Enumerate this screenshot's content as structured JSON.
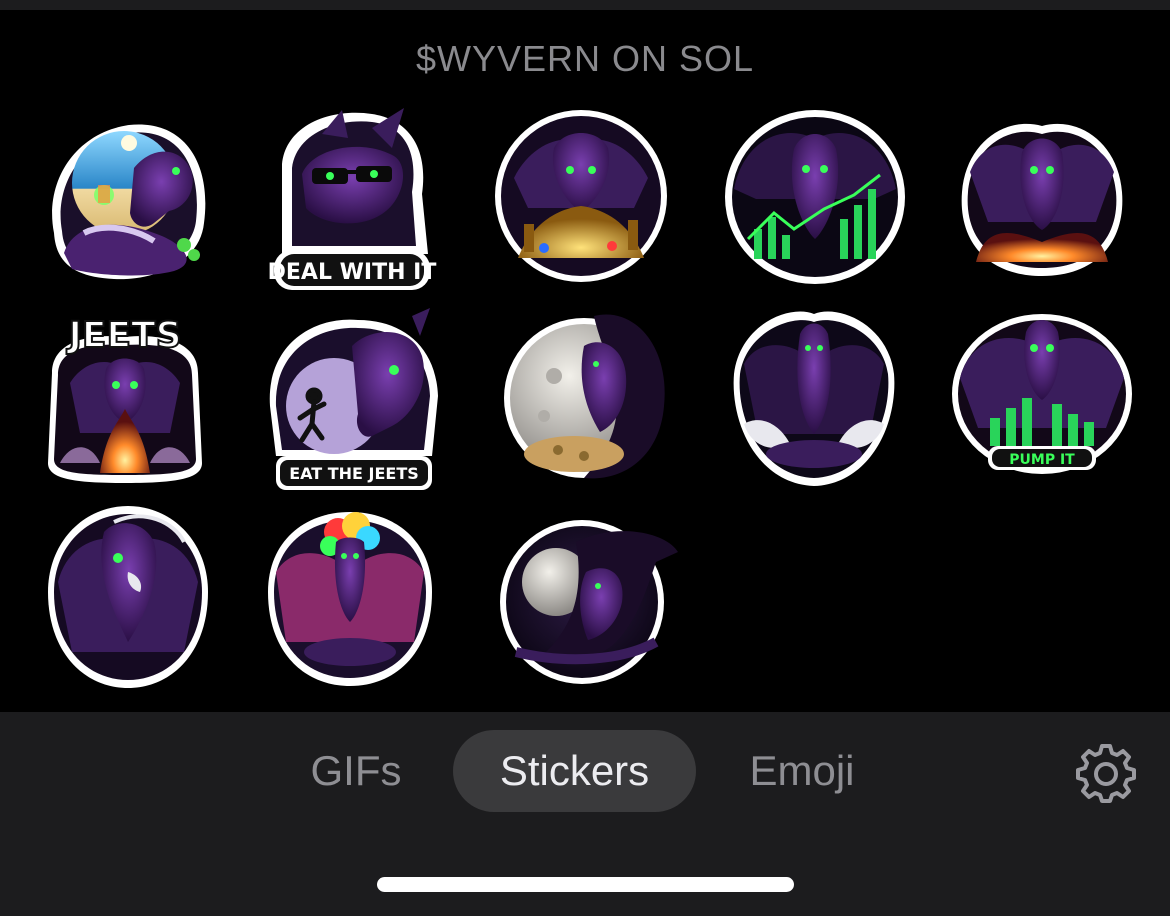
{
  "pack": {
    "title": "$WYVERN ON SOL"
  },
  "stickers": [
    {
      "name": "sticker-dragon-beach-drink",
      "caption": ""
    },
    {
      "name": "sticker-dragon-deal-with-it",
      "caption": "DEAL WITH IT"
    },
    {
      "name": "sticker-dragon-treasure-hoard",
      "caption": ""
    },
    {
      "name": "sticker-dragon-green-chart",
      "caption": ""
    },
    {
      "name": "sticker-dragon-fire-wings",
      "caption": ""
    },
    {
      "name": "sticker-dragon-jeets-fire",
      "caption": "JEETS"
    },
    {
      "name": "sticker-dragon-eat-the-jeets",
      "caption": "EAT THE JEETS"
    },
    {
      "name": "sticker-dragon-moon-coins",
      "caption": ""
    },
    {
      "name": "sticker-dragon-meditating",
      "caption": ""
    },
    {
      "name": "sticker-dragon-pump-it",
      "caption": "PUMP IT"
    },
    {
      "name": "sticker-dragon-roaring",
      "caption": ""
    },
    {
      "name": "sticker-dragon-clown-wig",
      "caption": ""
    },
    {
      "name": "sticker-dragon-night-moon",
      "caption": ""
    }
  ],
  "tabs": [
    {
      "label": "GIFs",
      "active": false
    },
    {
      "label": "Stickers",
      "active": true
    },
    {
      "label": "Emoji",
      "active": false
    }
  ],
  "icons": {
    "settings": "gear-icon"
  },
  "colors": {
    "background": "#000000",
    "bar": "#1c1c1e",
    "active_tab": "#3a3a3c",
    "dragon_purple": "#5b2a86",
    "eye_green": "#39ff5a"
  }
}
